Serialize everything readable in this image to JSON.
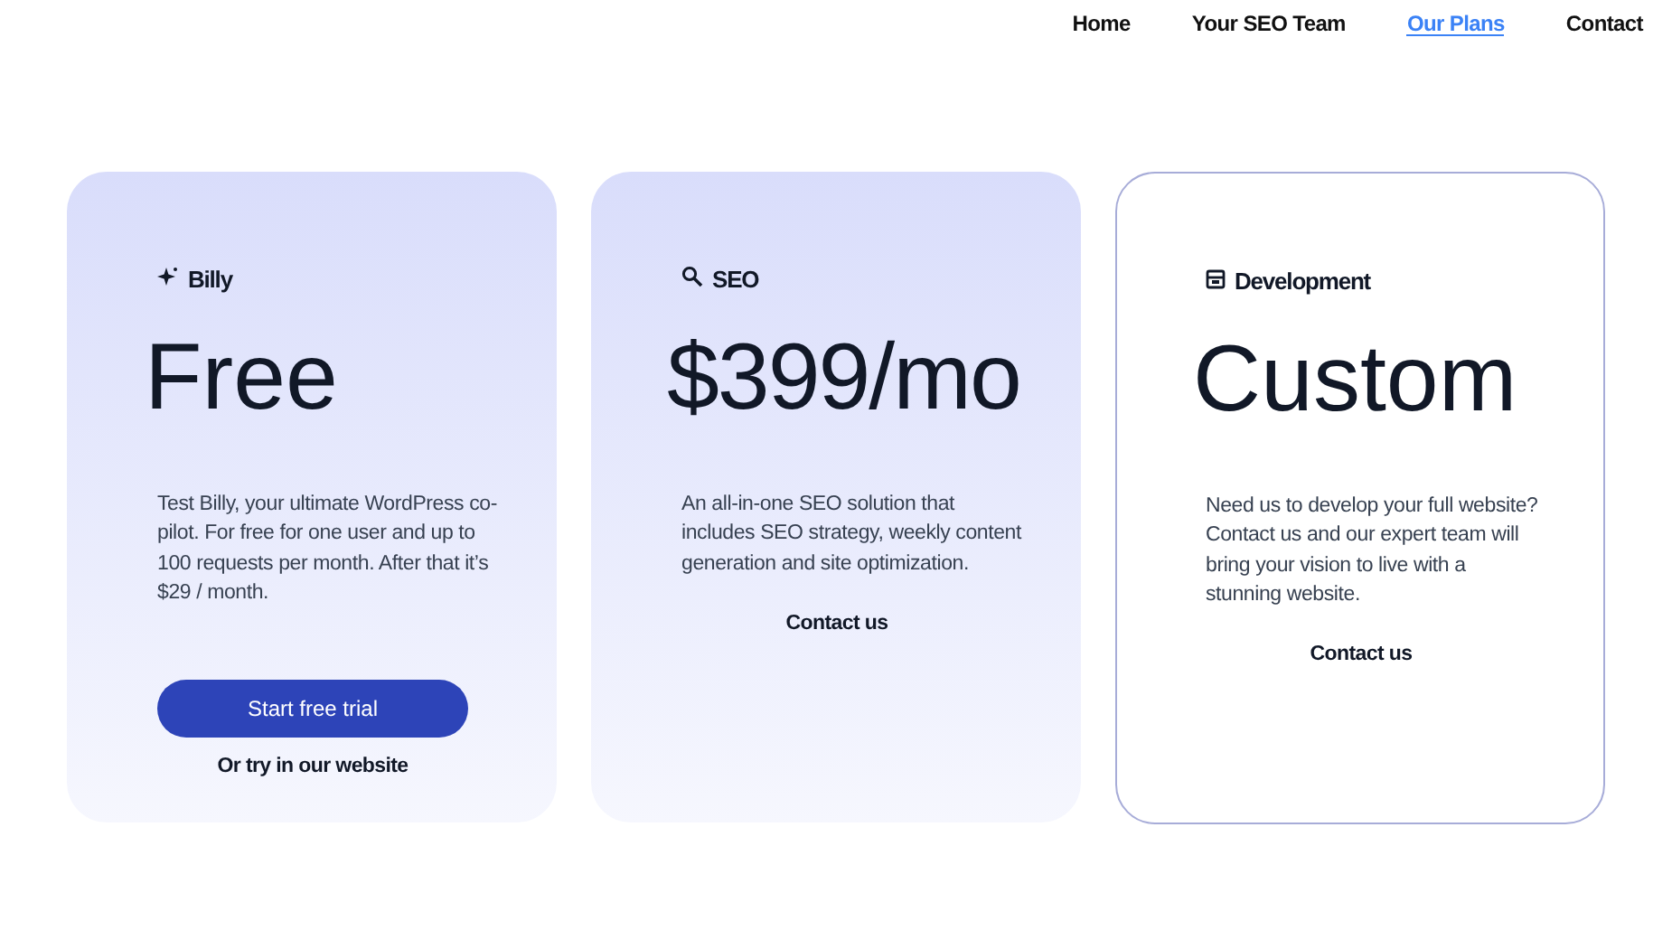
{
  "nav": [
    {
      "label": "Home",
      "selected": false
    },
    {
      "label": "Your SEO Team",
      "selected": false
    },
    {
      "label": "Our Plans",
      "selected": true
    },
    {
      "label": "Contact",
      "selected": false
    }
  ],
  "plans": [
    {
      "name": "Billy",
      "price": "Free",
      "kind": "gradient",
      "description": "Test Billy, your ultimate WordPress co-pilot. For free for one user and up to 100 requests per month. After that it’s $29 / month.",
      "button": "Start free trial",
      "link": "Or try in our website"
    },
    {
      "name": "SEO",
      "price": "$399/mo",
      "kind": "gradient",
      "description": "An all-in-one SEO solution that includes SEO strategy, weekly content generation and site optimization.",
      "link": "Contact us"
    },
    {
      "name": "Development",
      "price": "Custom",
      "kind": "outline",
      "description": "Need us to develop your full website? Contact us and our expert team will bring your vision to live with a stunning website.",
      "link": "Contact us"
    }
  ]
}
